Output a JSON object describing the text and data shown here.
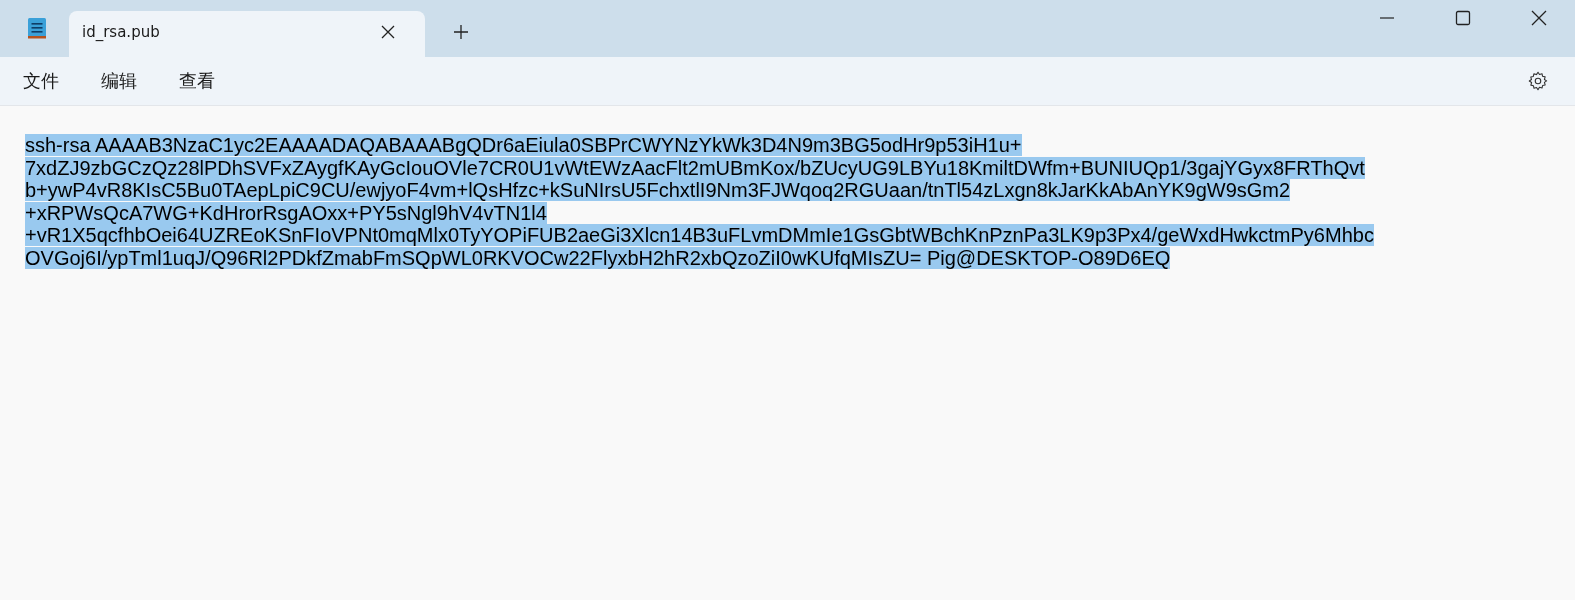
{
  "tabs": [
    {
      "label": "id_rsa.pub",
      "selected": true
    }
  ],
  "menu": [
    "文件",
    "编辑",
    "查看"
  ],
  "editor": {
    "selected": true,
    "lines": [
      "ssh-rsa AAAAB3NzaC1yc2EAAAADAQABAAABgQDr6aEiula0SBPrCWYNzYkWk3D4N9m3BG5odHr9p53iH1u+",
      "7xdZJ9zbGCzQz28lPDhSVFxZAygfKAyGcIouOVle7CR0U1vWtEWzAacFlt2mUBmKox/bZUcyUG9LBYu18KmiltDWfm+BUNIUQp1/3gajYGyx8FRThQvt",
      "b+ywP4vR8KIsC5Bu0TAepLpiC9CU/ewjyoF4vm+lQsHfzc+kSuNIrsU5FchxtlI9Nm3FJWqoq2RGUaan/tnTl54zLxgn8kJarKkAbAnYK9gW9sGm2",
      "+xRPWsQcA7WG+KdHrorRsgAOxx+PY5sNgl9hV4vTN1l4",
      "+vR1X5qcfhbOei64UZREoKSnFIoVPNt0mqMlx0TyYOPiFUB2aeGi3Xlcn14B3uFLvmDMmIe1GsGbtWBchKnPznPa3LK9p3Px4/geWxdHwkctmPy6Mhbc",
      "OVGoj6I/ypTml1uqJ/Q96Rl2PDkfZmabFmSQpWL0RKVOCw22FlyxbH2hR2xbQzoZiI0wKUfqMIsZU= Pig@DESKTOP-O89D6EQ"
    ]
  }
}
